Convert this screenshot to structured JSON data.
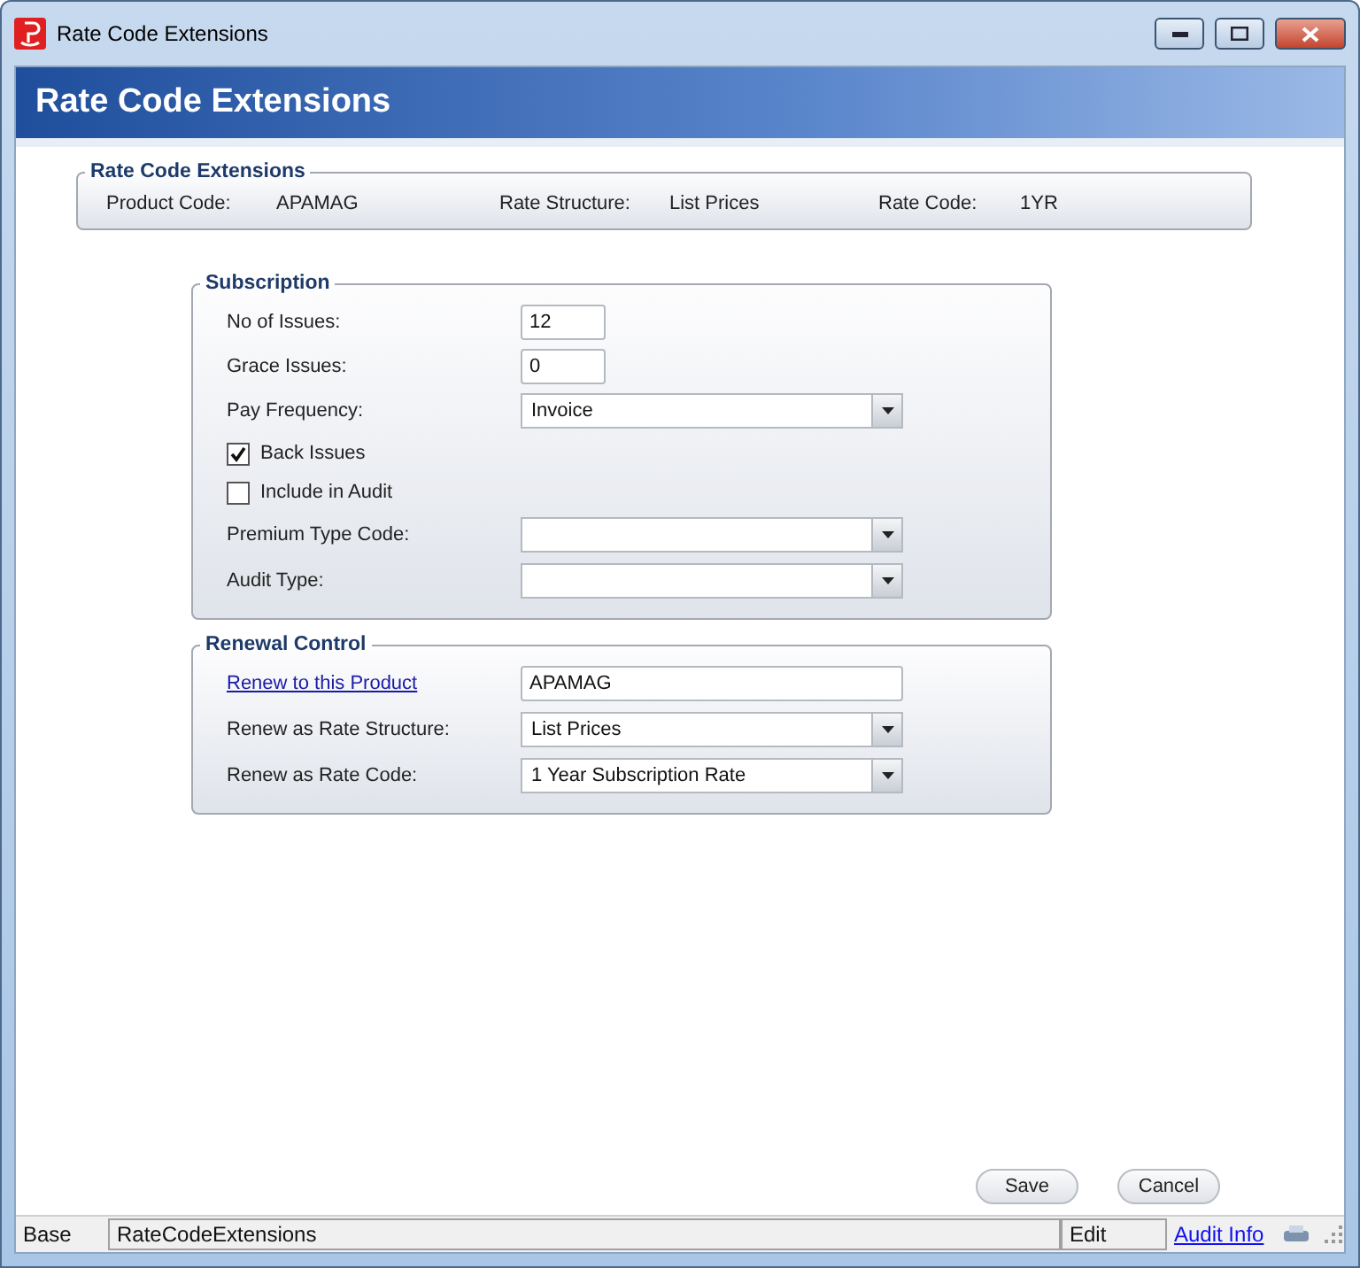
{
  "window": {
    "title": "Rate Code Extensions"
  },
  "header": {
    "title": "Rate Code Extensions"
  },
  "summary": {
    "legend": "Rate Code Extensions",
    "fields": [
      {
        "label": "Product Code:",
        "value": "APAMAG"
      },
      {
        "label": "Rate Structure:",
        "value": "List Prices"
      },
      {
        "label": "Rate Code:",
        "value": "1YR"
      }
    ]
  },
  "groups": [
    {
      "legend": "Subscription",
      "rows": [
        {
          "kind": "short-text",
          "label": "No of Issues:",
          "value": "12"
        },
        {
          "kind": "short-text",
          "label": "Grace Issues:",
          "value": "0"
        },
        {
          "kind": "select",
          "label": "Pay Frequency:",
          "value": "Invoice"
        },
        {
          "kind": "checkbox",
          "label": "Back Issues",
          "checked": true
        },
        {
          "kind": "checkbox",
          "label": "Include in Audit",
          "checked": false
        },
        {
          "kind": "select",
          "label": "Premium Type Code:",
          "value": ""
        },
        {
          "kind": "select",
          "label": "Audit Type:",
          "value": ""
        }
      ]
    },
    {
      "legend": "Renewal Control",
      "rows": [
        {
          "kind": "link-text",
          "label": "Renew to this Product",
          "value": "APAMAG"
        },
        {
          "kind": "select",
          "label": "Renew as Rate Structure:",
          "value": "List Prices"
        },
        {
          "kind": "select",
          "label": "Renew as Rate Code:",
          "value": "1 Year Subscription Rate"
        }
      ]
    }
  ],
  "buttons": [
    "Save",
    "Cancel"
  ],
  "status_bar": {
    "mode": "Base",
    "form": "RateCodeExtensions",
    "state": "Edit",
    "link": "Audit Info"
  }
}
